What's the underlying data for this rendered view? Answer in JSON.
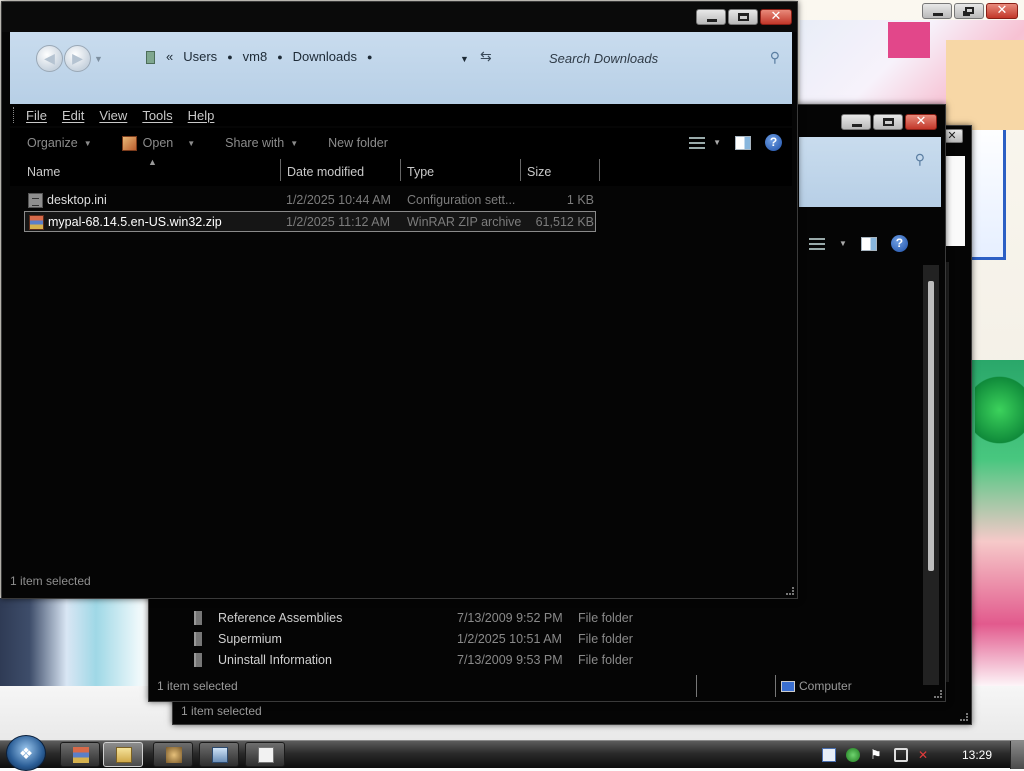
{
  "main_window": {
    "breadcrumb": {
      "overflow": "«",
      "items": [
        "Users",
        "vm8",
        "Downloads"
      ]
    },
    "search": {
      "placeholder": "Search Downloads"
    },
    "menu": [
      "File",
      "Edit",
      "View",
      "Tools",
      "Help"
    ],
    "toolbar": {
      "organize": "Organize",
      "open": "Open",
      "share_with": "Share with",
      "new_folder": "New folder"
    },
    "columns": {
      "name": "Name",
      "date": "Date modified",
      "type": "Type",
      "size": "Size"
    },
    "files": [
      {
        "name": "desktop.ini",
        "date": "1/2/2025 10:44 AM",
        "type": "Configuration sett...",
        "size": "1 KB",
        "icon": "settings-file-icon",
        "selected": false
      },
      {
        "name": "mypal-68.14.5.en-US.win32.zip",
        "date": "1/2/2025 11:12 AM",
        "type": "WinRAR ZIP archive",
        "size": "61,512 KB",
        "icon": "winrar-archive-icon",
        "selected": true
      }
    ],
    "status": "1 item selected"
  },
  "back_window_1": {
    "rows": [
      {
        "name": "Reference Assemblies",
        "date": "7/13/2009 9:52 PM",
        "type": "File folder"
      },
      {
        "name": "Supermium",
        "date": "1/2/2025 10:51 AM",
        "type": "File folder"
      },
      {
        "name": "Uninstall Information",
        "date": "7/13/2009 9:53 PM",
        "type": "File folder"
      }
    ],
    "status": "1 item selected",
    "location": "Computer"
  },
  "back_window_2": {
    "status": "1 item selected"
  },
  "taskbar": {
    "clock": "13:29",
    "pinned": [
      "winrar-icon",
      "windows-explorer-icon",
      "program-icon",
      "network-program-icon",
      "notepad-icon"
    ],
    "tray": [
      "document-tray-icon",
      "security-check-icon",
      "action-center-flag-icon",
      "network-icon",
      "volume-muted-icon"
    ]
  },
  "colors": {
    "address_band": "#c0d6eb",
    "window_bg": "#050505",
    "close_button": "#c2372a"
  }
}
